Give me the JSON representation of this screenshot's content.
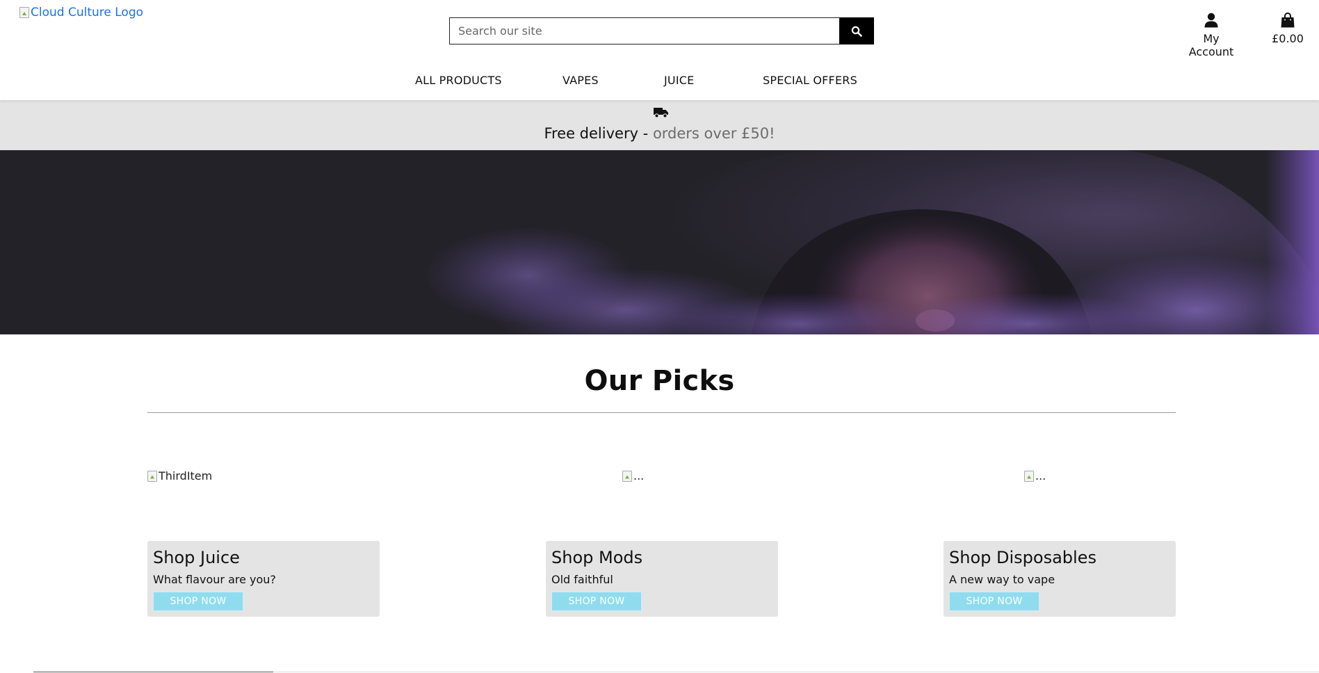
{
  "header": {
    "logo_alt": "Cloud Culture Logo",
    "search_placeholder": "Search our site",
    "account_label": "My Account",
    "bag_total": "£0.00"
  },
  "nav": {
    "items": [
      "ALL PRODUCTS",
      "VAPES",
      "JUICE",
      "SPECIAL OFFERS"
    ]
  },
  "delivery": {
    "lead": "Free delivery - ",
    "highlight": "orders over £50!"
  },
  "picks": {
    "title": "Our Picks",
    "image_alts": [
      "ThirdItem",
      "...",
      "..."
    ],
    "cards": [
      {
        "title": "Shop Juice",
        "subtitle": "What flavour are you?",
        "button": "SHOP NOW"
      },
      {
        "title": "Shop Mods",
        "subtitle": "Old faithful",
        "button": "SHOP NOW"
      },
      {
        "title": "Shop Disposables",
        "subtitle": "A new way to vape",
        "button": "SHOP NOW"
      }
    ]
  },
  "icons": {
    "search": "search-icon",
    "account": "user-icon",
    "bag": "shopping-bag-icon",
    "delivery": "truck-icon"
  },
  "colors": {
    "banner_bg": "#e4e4e4",
    "button_bg": "#8fdcef",
    "logo_link": "#1a73e8",
    "hero_purple": "#7a55c8"
  }
}
